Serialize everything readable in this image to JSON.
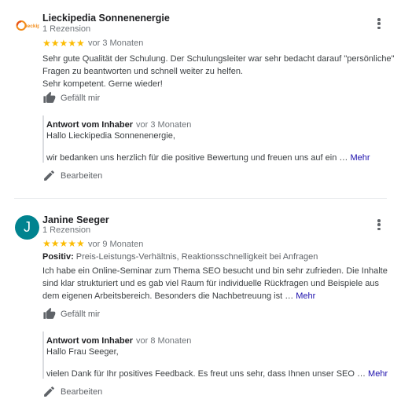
{
  "reviews": [
    {
      "author": "Lieckipedia Sonnenenergie",
      "logo_text": "lieckipedia",
      "review_count": "1 Rezension",
      "rating_stars": "★★★★★",
      "rating": 5,
      "time": "vor 3 Monaten",
      "text_line1": "Sehr gute Qualität der Schulung. Der Schulungsleiter war sehr bedacht darauf \"persönliche\" Fragen zu beantworten und schnell weiter zu helfen.",
      "text_line2": "Sehr kompetent. Gerne wieder!",
      "like_label": "Gefällt mir",
      "reply": {
        "owner_label": "Antwort vom Inhaber",
        "time": "vor 3 Monaten",
        "greeting": "Hallo Lieckipedia Sonnenenergie,",
        "text": "wir bedanken uns herzlich für die positive Bewertung und freuen uns auf ein …",
        "more_label": "Mehr",
        "edit_label": "Bearbeiten"
      }
    },
    {
      "author": "Janine Seeger",
      "avatar_letter": "J",
      "review_count": "1 Rezension",
      "rating_stars": "★★★★★",
      "rating": 5,
      "time": "vor 9 Monaten",
      "positive_label": "Positiv:",
      "positive_value": "Preis-Leistungs-Verhältnis, Reaktionsschnelligkeit bei Anfragen",
      "text": "Ich habe ein Online-Seminar zum Thema SEO besucht und bin sehr zufrieden. Die Inhalte sind klar strukturiert und es gab viel Raum für individuelle Rückfragen und Beispiele aus dem eigenen Arbeitsbereich. Besonders die Nachbetreuung ist …",
      "more_label": "Mehr",
      "like_label": "Gefällt mir",
      "reply": {
        "owner_label": "Antwort vom Inhaber",
        "time": "vor 8 Monaten",
        "greeting": "Hallo Frau Seeger,",
        "text": "vielen Dank für Ihr positives Feedback. Es freut uns sehr, dass Ihnen unser SEO …",
        "more_label": "Mehr",
        "edit_label": "Bearbeiten"
      }
    }
  ],
  "colors": {
    "star": "#fbbc04",
    "avatar_bg": "#00838f",
    "link": "#1a0dab",
    "icon": "#5f6368"
  },
  "icons": [
    "logo-icon",
    "more-vert-icon",
    "thumb-up-icon",
    "pencil-icon"
  ]
}
